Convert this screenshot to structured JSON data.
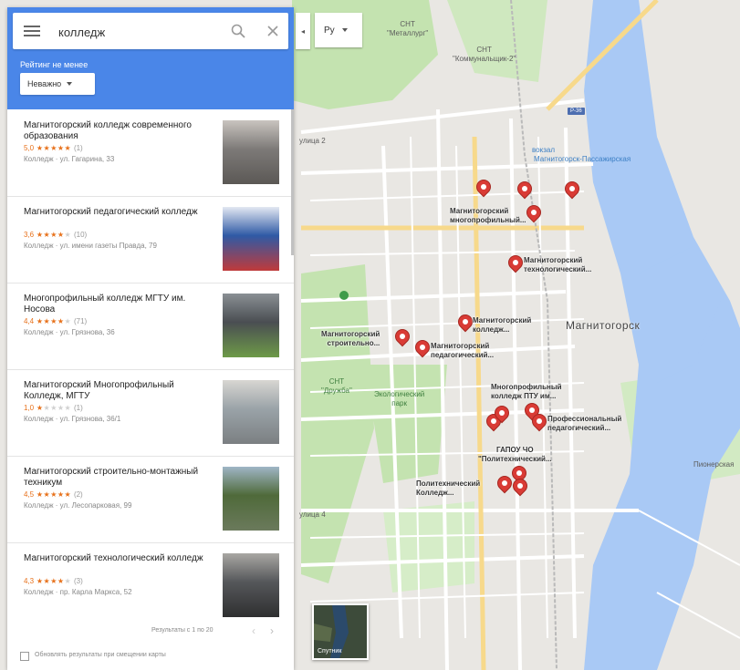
{
  "search": {
    "query": "колледж"
  },
  "filters": {
    "rating_label": "Рейтинг не менее",
    "sort_value": "Неважно"
  },
  "results": [
    {
      "name": "Магнитогорский колледж современного образования",
      "rating_value": "5,0",
      "stars_filled": 5,
      "reviews": "(1)",
      "address": "Колледж · ул. Гагарина, 33",
      "thumb_colors": [
        "#7d7a78",
        "#c9c4bf",
        "#5b5855"
      ]
    },
    {
      "name": "Магнитогорский педагогический колледж",
      "rating_value": "3,6",
      "stars_filled": 4,
      "reviews": "(10)",
      "address": "Колледж · ул. имени газеты Правда, 79",
      "thumb_colors": [
        "#2f5aa5",
        "#e3e8f2",
        "#c03a3a"
      ]
    },
    {
      "name": "Многопрофильный колледж МГТУ им. Носова",
      "rating_value": "4,4",
      "stars_filled": 4,
      "reviews": "(71)",
      "address": "Колледж · ул. Грязнова, 36",
      "thumb_colors": [
        "#4a4e52",
        "#8a8f94",
        "#6d9a48"
      ]
    },
    {
      "name": "Магнитогорский Многопрофильный Колледж, МГТУ",
      "rating_value": "1,0",
      "stars_filled": 1,
      "reviews": "(1)",
      "address": "Колледж · ул. Грязнова, 36/1",
      "thumb_colors": [
        "#9aa3a8",
        "#d8d6d2",
        "#7b7f82"
      ]
    },
    {
      "name": "Магнитогорский строительно-монтажный техникум",
      "rating_value": "4,5",
      "stars_filled": 5,
      "reviews": "(2)",
      "address": "Колледж · ул. Лесопарковая, 99",
      "thumb_colors": [
        "#4f6a3a",
        "#9fb5c6",
        "#6b7a5c"
      ]
    },
    {
      "name": "Магнитогорский технологический колледж",
      "rating_value": "4,3",
      "stars_filled": 4,
      "reviews": "(3)",
      "address": "Колледж · пр. Карла Маркса, 52",
      "thumb_colors": [
        "#55575a",
        "#a9a7a3",
        "#2f2f30"
      ]
    }
  ],
  "pager": {
    "text": "Результаты с 1 по 20",
    "prev": "‹",
    "next": "›"
  },
  "update_on_move": "Обновлять результаты при смещении карты",
  "controls": {
    "collapse": "◂",
    "language": "Ру",
    "satellite": "Спутник"
  },
  "map": {
    "city": "Магнитогорск",
    "labels": [
      {
        "text": "СНТ\n\"Металлург\"",
        "style": ""
      },
      {
        "text": "СНТ\n\"Коммунальщик-2\"",
        "style": ""
      },
      {
        "text": "Магнитогорск-Пассажирская",
        "style": "blue"
      },
      {
        "text": "вокзал",
        "style": "blue"
      },
      {
        "text": "СНТ\n\"Дружба\"",
        "style": "green"
      },
      {
        "text": "Экологический\nпарк",
        "style": "green"
      },
      {
        "text": "улица 2",
        "style": ""
      },
      {
        "text": "улица 4",
        "style": ""
      },
      {
        "text": "Пионерская",
        "style": ""
      }
    ],
    "pois": [
      "Магнитогорский\nмногопрофильный...",
      "Магнитогорский\nтехнологический...",
      "Магнитогорский\nколледж...",
      "Магнитогорский\nстроительно...",
      "Магнитогорский\nпедагогический...",
      "Многопрофильный\nколледж ПТУ им...",
      "Профессиональный\nпедагогический...",
      "ГАПОУ ЧО\n\"Политехнический...",
      "Политехнический\nКолледж..."
    ],
    "road_shield": "Р-36"
  },
  "colors": {
    "header": "#4a86e8",
    "pin": "#d93b35",
    "star": "#e7711b",
    "water": "#a9c9f5",
    "park": "#c4e3b0"
  }
}
